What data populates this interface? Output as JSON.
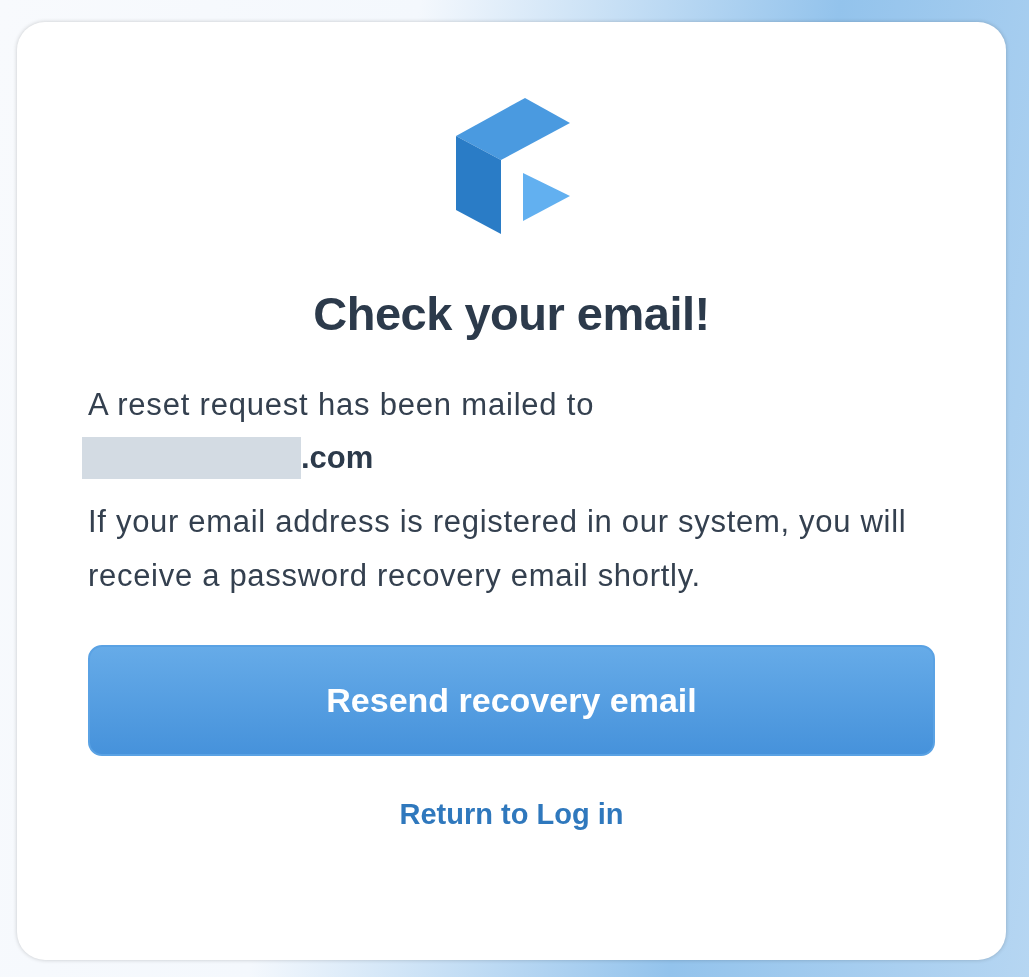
{
  "title": "Check your email!",
  "message": "A reset request has been mailed to",
  "email": {
    "redacted": true,
    "visible_text": ".com"
  },
  "note": "If your email address is registered in our system, you will receive a password recovery email shortly.",
  "primary_button": "Resend recovery email",
  "link": "Return to Log in"
}
